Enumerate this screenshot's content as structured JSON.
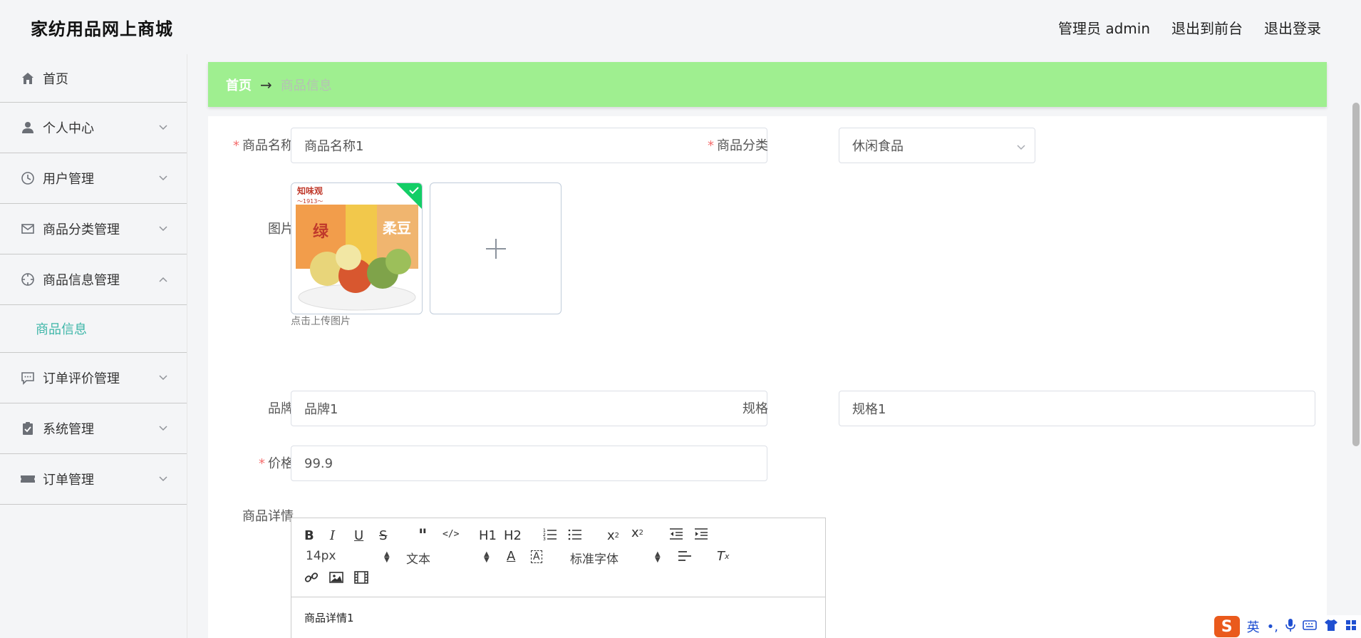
{
  "header": {
    "brand": "家纺用品网上商城",
    "admin": "管理员 admin",
    "to_front": "退出到前台",
    "logout": "退出登录"
  },
  "sidebar": {
    "items": [
      {
        "label": "首页",
        "icon": "home-icon"
      },
      {
        "label": "个人中心",
        "icon": "user-icon"
      },
      {
        "label": "用户管理",
        "icon": "clock-icon"
      },
      {
        "label": "商品分类管理",
        "icon": "mail-icon"
      },
      {
        "label": "商品信息管理",
        "icon": "compass-icon"
      },
      {
        "label": "订单评价管理",
        "icon": "chat-icon"
      },
      {
        "label": "系统管理",
        "icon": "clipboard-icon"
      },
      {
        "label": "订单管理",
        "icon": "ticket-icon"
      }
    ],
    "submenu_active": "商品信息"
  },
  "breadcrumb": {
    "home": "首页",
    "arrow": "→",
    "current": "商品信息"
  },
  "form": {
    "name_label": "商品名称",
    "name_value": "商品名称1",
    "category_label": "商品分类",
    "category_value": "休闲食品",
    "image_label": "图片",
    "upload_tip": "点击上传图片",
    "brand_label": "品牌",
    "brand_value": "品牌1",
    "spec_label": "规格",
    "spec_value": "规格1",
    "price_label": "价格",
    "price_value": "99.9",
    "detail_label": "商品详情"
  },
  "product_image": {
    "brand_text": "知味观",
    "sub_text": "〜1913〜",
    "word1": "绿",
    "word2": "柔豆"
  },
  "editor": {
    "font_size": "14px",
    "text_type": "文本",
    "font_family": "标准字体",
    "content": "商品详情1",
    "h1": "H1",
    "h2": "H2"
  },
  "ime": {
    "logo": "S",
    "lang": "英"
  }
}
